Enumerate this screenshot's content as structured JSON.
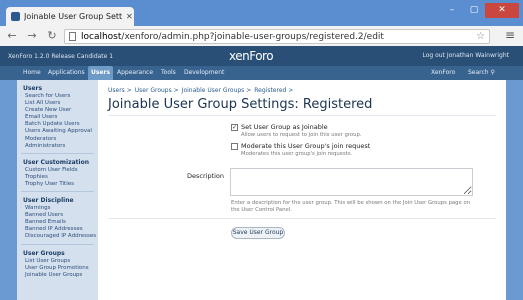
{
  "browser": {
    "tab_title": "Joinable User Group Settin",
    "url_host": "localhost",
    "url_path": "/xenforo/admin.php?joinable-user-groups/registered.2/edit"
  },
  "header": {
    "version": "XenForo 1.2.0 Release Candidate 1",
    "logo_xen": "xen",
    "logo_foro": "Foro",
    "logout": "Log out Jonathan Wainwright"
  },
  "nav": {
    "items": [
      "Home",
      "Applications",
      "Users",
      "Appearance",
      "Tools",
      "Development"
    ],
    "active": "Users",
    "right_link": "XenForo",
    "search_label": "Search"
  },
  "sidebar": {
    "groups": [
      {
        "heading": "Users",
        "items": [
          "Search for Users",
          "List All Users",
          "Create New User",
          "Email Users",
          "Batch Update Users",
          "Users Awaiting Approval",
          "Moderators",
          "Administrators"
        ]
      },
      {
        "heading": "User Customization",
        "items": [
          "Custom User Fields",
          "Trophies",
          "Trophy User Titles"
        ]
      },
      {
        "heading": "User Discipline",
        "items": [
          "Warnings",
          "Banned Users",
          "Banned Emails",
          "Banned IP Addresses",
          "Discouraged IP Addresses"
        ]
      },
      {
        "heading": "User Groups",
        "items": [
          "List User Groups",
          "User Group Promotions",
          "Joinable User Groups"
        ]
      }
    ]
  },
  "main": {
    "breadcrumb": [
      "Users >",
      "User Groups >",
      "Joinable User Groups >",
      "Registered >"
    ],
    "title": "Joinable User Group Settings: Registered",
    "options": [
      {
        "label": "Set User Group as Joinable",
        "hint": "Allow users to request to join this user group.",
        "checked": true
      },
      {
        "label": "Moderate this User Group's join request",
        "hint": "Moderates this user group's join requests.",
        "checked": false
      }
    ],
    "description_label": "Description",
    "description_value": "",
    "description_hint": "Enter a description for the user group. This will be shown on the Join User Groups page on the User Control Panel.",
    "save_label": "Save User Group"
  }
}
